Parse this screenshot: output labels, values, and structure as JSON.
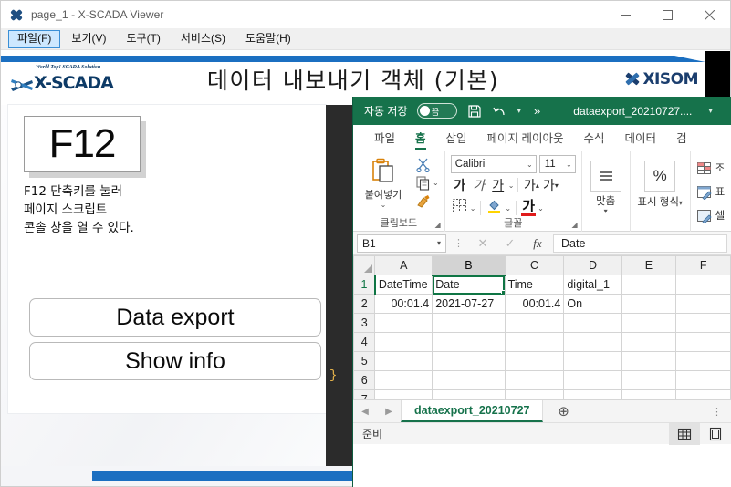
{
  "scada": {
    "title": "page_1 - X-SCADA Viewer",
    "app_icon": "xscada-puzzle-icon",
    "window_buttons": {
      "minimize": "minimize-icon",
      "maximize": "maximize-icon",
      "close": "close-icon"
    },
    "menu": [
      {
        "label": "파일(F)",
        "active": true
      },
      {
        "label": "보기(V)",
        "active": false
      },
      {
        "label": "도구(T)",
        "active": false
      },
      {
        "label": "서비스(S)",
        "active": false
      },
      {
        "label": "도움말(H)",
        "active": false
      }
    ],
    "page_title": "데이터 내보내기 객체 (기본)",
    "logo_left": {
      "tagline": "World Top! SCADA Solution",
      "word": "X-SCADA"
    },
    "logo_right": {
      "word": "XISOM"
    },
    "f12": {
      "key_label": "F12",
      "description": "F12 단축키를 눌러\n페이지 스크립트\n콘솔 창을 열 수 있다."
    },
    "buttons": [
      {
        "label": "Data export"
      },
      {
        "label": "Show info"
      }
    ],
    "code_panel": {
      "brace": "}"
    },
    "colors": {
      "accent_blue": "#1b6fc1",
      "code_bg": "#2b2b2b",
      "brace": "#e3b14a"
    }
  },
  "excel": {
    "titlebar": {
      "autosave_label": "자동 저장",
      "autosave_state": "끔",
      "save_icon": "save-icon",
      "undo_icon": "undo-icon",
      "more_icon": "more-chevron-icon",
      "document_title": "dataexport_20210727....",
      "title_caret": "▾"
    },
    "ribbon_tabs": [
      {
        "label": "파일",
        "active": false
      },
      {
        "label": "홈",
        "active": true
      },
      {
        "label": "삽입",
        "active": false
      },
      {
        "label": "페이지 레이아웃",
        "active": false
      },
      {
        "label": "수식",
        "active": false
      },
      {
        "label": "데이터",
        "active": false
      },
      {
        "label": "검",
        "active": false
      }
    ],
    "ribbon": {
      "clipboard": {
        "group_label": "클립보드",
        "paste_label": "붙여넣기",
        "paste_icon": "paste-clipboard-icon",
        "cut_icon": "scissors-icon",
        "copy_icon": "copy-icon",
        "format_painter_icon": "format-painter-brush-icon",
        "expander_icon": "dialog-launcher-icon"
      },
      "font": {
        "group_label": "글꼴",
        "font_name": "Calibri",
        "font_size": "11",
        "bold_label": "가",
        "italic_label": "가",
        "underline_label": "가",
        "grow_label": "가",
        "shrink_label": "가",
        "border_icon": "borders-icon",
        "fill_icon": "fill-color-icon",
        "font_color_label": "가",
        "expander_icon": "dialog-launcher-icon"
      },
      "alignment": {
        "group_label": "맞춤",
        "icon": "align-lines-icon",
        "caret": "▾"
      },
      "number": {
        "group_label": "표시 형식",
        "icon": "percent-icon",
        "caret": "▾"
      },
      "styles": [
        {
          "label": "조",
          "icon": "conditional-formatting-icon"
        },
        {
          "label": "표",
          "icon": "format-as-table-icon"
        },
        {
          "label": "셀",
          "icon": "cell-styles-icon"
        }
      ]
    },
    "formula_bar": {
      "name_box": "B1",
      "name_box_caret": "▾",
      "cancel_icon": "cancel-x-icon",
      "confirm_icon": "confirm-check-icon",
      "function_icon": "fx",
      "value": "Date"
    },
    "grid": {
      "columns": [
        "A",
        "B",
        "C",
        "D",
        "E",
        "F"
      ],
      "rows": [
        "1",
        "2",
        "3",
        "4",
        "5",
        "6",
        "7"
      ],
      "selected_cell": "B1",
      "data": [
        {
          "A": "DateTime",
          "B": "Date",
          "C": "Time",
          "D": "digital_1",
          "E": "",
          "F": ""
        },
        {
          "A": "00:01.4",
          "B": "2021-07-27",
          "C": "00:01.4",
          "D": "On",
          "E": "",
          "F": ""
        },
        {
          "A": "",
          "B": "",
          "C": "",
          "D": "",
          "E": "",
          "F": ""
        },
        {
          "A": "",
          "B": "",
          "C": "",
          "D": "",
          "E": "",
          "F": ""
        },
        {
          "A": "",
          "B": "",
          "C": "",
          "D": "",
          "E": "",
          "F": ""
        },
        {
          "A": "",
          "B": "",
          "C": "",
          "D": "",
          "E": "",
          "F": ""
        },
        {
          "A": "",
          "B": "",
          "C": "",
          "D": "",
          "E": "",
          "F": ""
        }
      ]
    },
    "sheet_bar": {
      "prev_icon": "nav-prev-icon",
      "next_icon": "nav-next-icon",
      "tab_name": "dataexport_20210727",
      "add_sheet_icon": "add-sheet-plus-icon",
      "dots_icon": "more-dots-icon"
    },
    "status_bar": {
      "text": "준비",
      "normal_view_icon": "normal-view-icon",
      "page_layout_icon": "page-layout-view-icon"
    },
    "colors": {
      "green": "#16724b",
      "selection": "#0f7544"
    }
  }
}
